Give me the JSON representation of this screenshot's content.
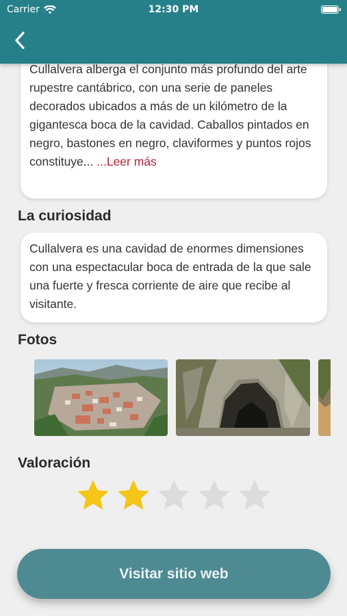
{
  "status_bar": {
    "carrier": "Carrier",
    "time": "12:30 PM",
    "icons": [
      "wifi-icon",
      "battery-icon"
    ]
  },
  "nav": {
    "back_icon": "chevron-left-icon"
  },
  "description": {
    "text": "Cullalvera alberga el conjunto más profundo del arte rupestre cantábrico, con una serie de paneles decorados ubicados a más de un kilómetro de la gigantesca boca de la cavidad. Caballos pintados en negro, bastones en negro, claviformes y puntos rojos constituye...",
    "read_more": " ...Leer más"
  },
  "curiosity": {
    "title": "La curiosidad",
    "text": "Cullalvera es una cavidad de enormes dimensiones con una espectacular boca de entrada de la que sale una fuerte y fresca corriente de aire que recibe al visitante."
  },
  "photos": {
    "title": "Fotos",
    "items": [
      "town-aerial-photo",
      "cave-entrance-photo",
      "third-photo"
    ]
  },
  "rating": {
    "title": "Valoración",
    "value": 2,
    "max": 5,
    "filled_color": "#f5c518",
    "empty_color": "#dcdcdc"
  },
  "cta": {
    "label": "Visitar sitio web"
  },
  "colors": {
    "header": "#26808a",
    "button": "#4e8a91",
    "link": "#b3263a"
  }
}
